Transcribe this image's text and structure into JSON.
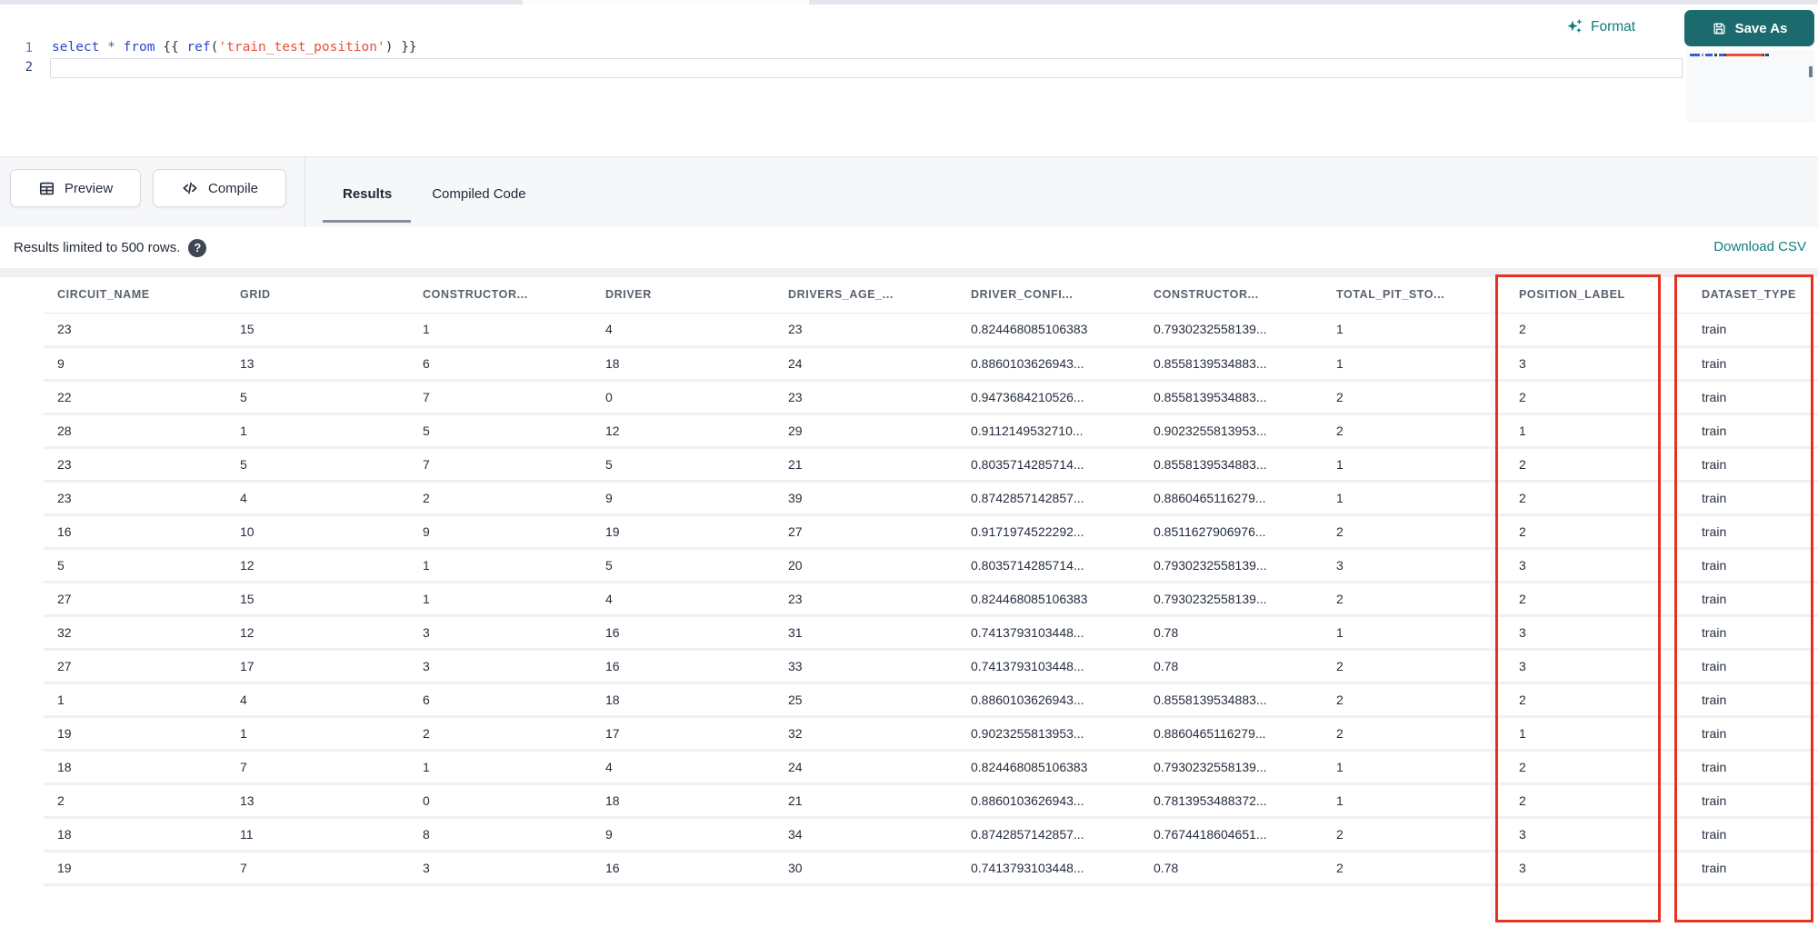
{
  "app": {
    "accent_teal": "#0e7d80",
    "button_teal": "#1b6b6e",
    "highlight_red": "#e8301f"
  },
  "editor": {
    "line_numbers": [
      "1",
      "2"
    ],
    "code": "select * from {{ ref('train_test_position') }}",
    "tokens": [
      [
        "select",
        "kw"
      ],
      [
        " ",
        "plain"
      ],
      [
        "*",
        "op"
      ],
      [
        " ",
        "plain"
      ],
      [
        "from",
        "kw"
      ],
      [
        " ",
        "plain"
      ],
      [
        "{{",
        "brace"
      ],
      [
        " ",
        "plain"
      ],
      [
        "ref",
        "kw"
      ],
      [
        "(",
        "brace"
      ],
      [
        "'train_test_position'",
        "str"
      ],
      [
        ")",
        "brace"
      ],
      [
        " ",
        "plain"
      ],
      [
        "}}",
        "brace"
      ]
    ]
  },
  "header_actions": {
    "format_label": "Format",
    "save_as_label": "Save As"
  },
  "toolbar": {
    "preview_label": "Preview",
    "compile_label": "Compile"
  },
  "tabs": [
    {
      "label": "Results",
      "active": true
    },
    {
      "label": "Compiled Code",
      "active": false
    }
  ],
  "results": {
    "limit_notice": "Results limited to 500 rows.",
    "help_glyph": "?",
    "download_label": "Download CSV",
    "table": {
      "columns": [
        "CIRCUIT_NAME",
        "GRID",
        "CONSTRUCTOR...",
        "DRIVER",
        "DRIVERS_AGE_...",
        "DRIVER_CONFI...",
        "CONSTRUCTOR...",
        "TOTAL_PIT_STO...",
        "POSITION_LABEL",
        "DATASET_TYPE"
      ],
      "highlighted_columns": [
        8,
        9
      ],
      "rows": [
        [
          "23",
          "15",
          "1",
          "4",
          "23",
          "0.824468085106383",
          "0.7930232558139...",
          "1",
          "2",
          "train"
        ],
        [
          "9",
          "13",
          "6",
          "18",
          "24",
          "0.8860103626943...",
          "0.8558139534883...",
          "1",
          "3",
          "train"
        ],
        [
          "22",
          "5",
          "7",
          "0",
          "23",
          "0.9473684210526...",
          "0.8558139534883...",
          "2",
          "2",
          "train"
        ],
        [
          "28",
          "1",
          "5",
          "12",
          "29",
          "0.9112149532710...",
          "0.9023255813953...",
          "2",
          "1",
          "train"
        ],
        [
          "23",
          "5",
          "7",
          "5",
          "21",
          "0.8035714285714...",
          "0.8558139534883...",
          "1",
          "2",
          "train"
        ],
        [
          "23",
          "4",
          "2",
          "9",
          "39",
          "0.8742857142857...",
          "0.8860465116279...",
          "1",
          "2",
          "train"
        ],
        [
          "16",
          "10",
          "9",
          "19",
          "27",
          "0.9171974522292...",
          "0.8511627906976...",
          "2",
          "2",
          "train"
        ],
        [
          "5",
          "12",
          "1",
          "5",
          "20",
          "0.8035714285714...",
          "0.7930232558139...",
          "3",
          "3",
          "train"
        ],
        [
          "27",
          "15",
          "1",
          "4",
          "23",
          "0.824468085106383",
          "0.7930232558139...",
          "2",
          "2",
          "train"
        ],
        [
          "32",
          "12",
          "3",
          "16",
          "31",
          "0.7413793103448...",
          "0.78",
          "1",
          "3",
          "train"
        ],
        [
          "27",
          "17",
          "3",
          "16",
          "33",
          "0.7413793103448...",
          "0.78",
          "2",
          "3",
          "train"
        ],
        [
          "1",
          "4",
          "6",
          "18",
          "25",
          "0.8860103626943...",
          "0.8558139534883...",
          "2",
          "2",
          "train"
        ],
        [
          "19",
          "1",
          "2",
          "17",
          "32",
          "0.9023255813953...",
          "0.8860465116279...",
          "2",
          "1",
          "train"
        ],
        [
          "18",
          "7",
          "1",
          "4",
          "24",
          "0.824468085106383",
          "0.7930232558139...",
          "1",
          "2",
          "train"
        ],
        [
          "2",
          "13",
          "0",
          "18",
          "21",
          "0.8860103626943...",
          "0.7813953488372...",
          "1",
          "2",
          "train"
        ],
        [
          "18",
          "11",
          "8",
          "9",
          "34",
          "0.8742857142857...",
          "0.7674418604651...",
          "2",
          "3",
          "train"
        ],
        [
          "19",
          "7",
          "3",
          "16",
          "30",
          "0.7413793103448...",
          "0.78",
          "2",
          "3",
          "train"
        ]
      ]
    }
  }
}
